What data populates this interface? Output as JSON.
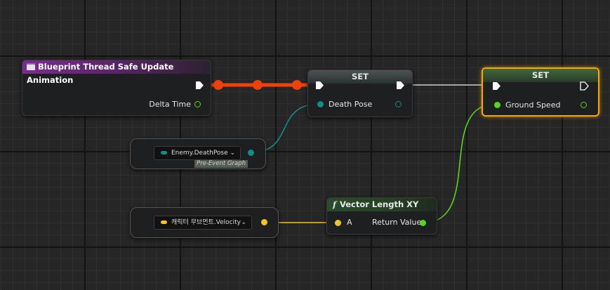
{
  "colors": {
    "exec_active": "#f0410a",
    "exec_wire": "#cfcfcf",
    "pose": "#0f8f87",
    "float": "#58d61a",
    "vector": "#f5c320",
    "selection": "#f5a80a",
    "event_header": "#7a2d8e"
  },
  "event_node": {
    "icon": "blueprint-event-icon",
    "title": "Blueprint Thread Safe Update Animation",
    "delta_time_label": "Delta Time"
  },
  "set_death_pose": {
    "title": "SET",
    "input_label": "Death Pose"
  },
  "set_ground_speed": {
    "title": "SET",
    "input_label": "Ground Speed"
  },
  "death_pose_getter": {
    "variable": "Enemy.DeathPose",
    "badge": "Pre-Event Graph"
  },
  "velocity_getter": {
    "variable": "캐릭터 무브먼트.Velocity"
  },
  "vector_length_node": {
    "icon": "function-icon",
    "title": "Vector Length XY",
    "input_label": "A",
    "output_label": "Return Value"
  }
}
